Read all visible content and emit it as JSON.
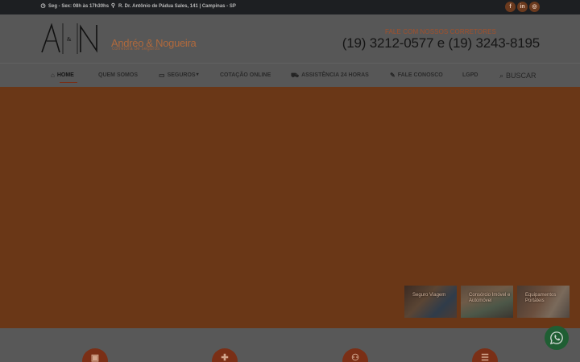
{
  "topbar": {
    "hours": "Seg - Sex: 08h às 17h30hs",
    "address": "R. Dr. Antônio de Pádua Sales, 141 | Campinas - SP",
    "social": [
      {
        "name": "facebook-icon",
        "glyph": "f"
      },
      {
        "name": "linkedin-icon",
        "glyph": "in"
      },
      {
        "name": "instagram-icon",
        "glyph": "◎"
      }
    ]
  },
  "header": {
    "logo_letters": "A&N",
    "brand_name": "Andréo & Nogueira",
    "brand_tagline": "corretora de seguros",
    "call_label": "FALE COM NOSSOS CORRETORES",
    "phones": "(19) 3212-0577 e (19) 3243-8195"
  },
  "nav": {
    "items": [
      {
        "label": "HOME",
        "icon": "home-icon",
        "active": true
      },
      {
        "label": "QUEM SOMOS",
        "icon": "",
        "active": false
      },
      {
        "label": "SEGUROS",
        "icon": "folder-icon",
        "active": false
      },
      {
        "label": "COTAÇÃO ONLINE",
        "icon": "",
        "active": false
      },
      {
        "label": "ASSISTÊNCIA 24 HORAS",
        "icon": "truck-icon",
        "active": false
      },
      {
        "label": "FALE CONOSCO",
        "icon": "edit-icon",
        "active": false
      },
      {
        "label": "LGPD",
        "icon": "",
        "active": false
      }
    ],
    "search_label": "BUSCAR"
  },
  "hero": {
    "thumbnails": [
      {
        "caption": "Seguro Viagem"
      },
      {
        "caption": "Consórcio Imóvel e Automóvel"
      },
      {
        "caption": "Equipamentos Portáteis"
      }
    ]
  },
  "colors": {
    "accent": "#b0693c",
    "hero_bg": "#6a3717",
    "overlay": "#575757",
    "feature_circle": "#7a2f16",
    "whatsapp": "#1f5e33"
  }
}
